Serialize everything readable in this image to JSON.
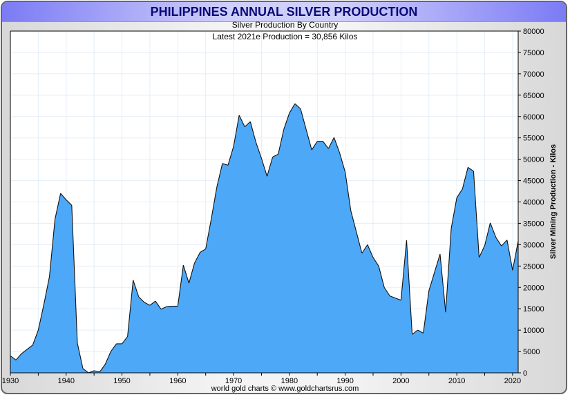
{
  "chart_data": {
    "type": "area",
    "title": "PHILIPPINES ANNUAL SILVER PRODUCTION",
    "subtitle": "Silver Production By Country",
    "annotation": "Latest 2021e Production = 30,856 Kilos",
    "footer": "world gold charts © www.goldchartsrus.com",
    "xlabel": "",
    "ylabel": "Silver Mining Production - Kilos",
    "xlim": [
      1930,
      2021
    ],
    "ylim": [
      0,
      80000
    ],
    "xticks": [
      1930,
      1940,
      1950,
      1960,
      1970,
      1980,
      1990,
      2000,
      2010,
      2020
    ],
    "yticks": [
      0,
      5000,
      10000,
      15000,
      20000,
      25000,
      30000,
      35000,
      40000,
      45000,
      50000,
      55000,
      60000,
      65000,
      70000,
      75000,
      80000
    ],
    "grid": true,
    "fill_color": "#4da9f7",
    "x_start": 1930,
    "values": [
      4000,
      3000,
      4500,
      5500,
      6500,
      10000,
      16000,
      22500,
      36000,
      42000,
      40500,
      39200,
      7000,
      1000,
      0,
      500,
      200,
      2000,
      5000,
      6800,
      6800,
      8500,
      21700,
      17800,
      16500,
      15800,
      16800,
      14900,
      15500,
      15600,
      15600,
      25200,
      21000,
      25700,
      28200,
      29000,
      36000,
      43500,
      49000,
      48600,
      53000,
      60300,
      57600,
      58800,
      54000,
      50200,
      46000,
      50500,
      51200,
      57000,
      60800,
      63000,
      61800,
      57000,
      52200,
      54200,
      54200,
      52500,
      55100,
      51500,
      47000,
      38000,
      33000,
      28000,
      30000,
      27000,
      25000,
      20000,
      18000,
      17500,
      17000,
      31000,
      9000,
      10000,
      9300,
      19200,
      23500,
      27800,
      14200,
      33800,
      41000,
      43000,
      48100,
      47200,
      27000,
      29800,
      35100,
      31700,
      29700,
      31100,
      24000,
      30856
    ]
  }
}
